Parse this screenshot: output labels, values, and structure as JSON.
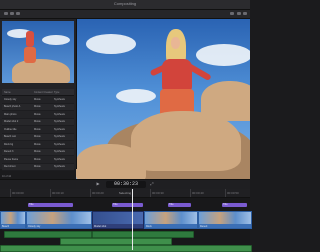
{
  "window": {
    "title": "Compositing"
  },
  "inspector": {
    "columns": [
      "Name",
      "Content Created",
      "Type"
    ],
    "rows": [
      [
        "Cloudy sky",
        "Movie",
        "Synthesis"
      ],
      [
        "Beach photo A",
        "Movie",
        "Synthesis"
      ],
      [
        "Main photo",
        "Movie",
        "Synthesis"
      ],
      [
        "Model shot 2",
        "Movie",
        "Synthesis"
      ],
      [
        "Outline title",
        "Movie",
        "Synthesis"
      ],
      [
        "Beach rest",
        "Movie",
        "Synthesis"
      ],
      [
        "Rock bg",
        "Movie",
        "Synthesis"
      ],
      [
        "Desert 3",
        "Movie",
        "Synthesis"
      ],
      [
        "Pause frame",
        "Movie",
        "Synthesis"
      ],
      [
        "Red shoot",
        "Movie",
        "Synthesis"
      ]
    ],
    "footer": "10 of 44"
  },
  "transport": {
    "timecode": "00:30:23"
  },
  "ruler": {
    "zoom_label": "Selecting",
    "ticks": [
      "00:00:00",
      "00:00:10",
      "00:00:20",
      "00:00:30",
      "00:00:40",
      "00:00:50"
    ]
  },
  "timeline": {
    "connected": [
      "Title",
      "Title",
      "Title",
      "Title"
    ],
    "clips": [
      "Beach",
      "Cloudy sky",
      "Model shot",
      "Rock",
      "Desert"
    ],
    "audio": [
      "Cloudy Audio",
      "Beach Audio",
      "Rock Audio",
      "Desert Audio"
    ]
  },
  "colors": {
    "accent": "#7a5bd1",
    "clip": "#3b6fb6",
    "audio": "#2f7a3e"
  }
}
